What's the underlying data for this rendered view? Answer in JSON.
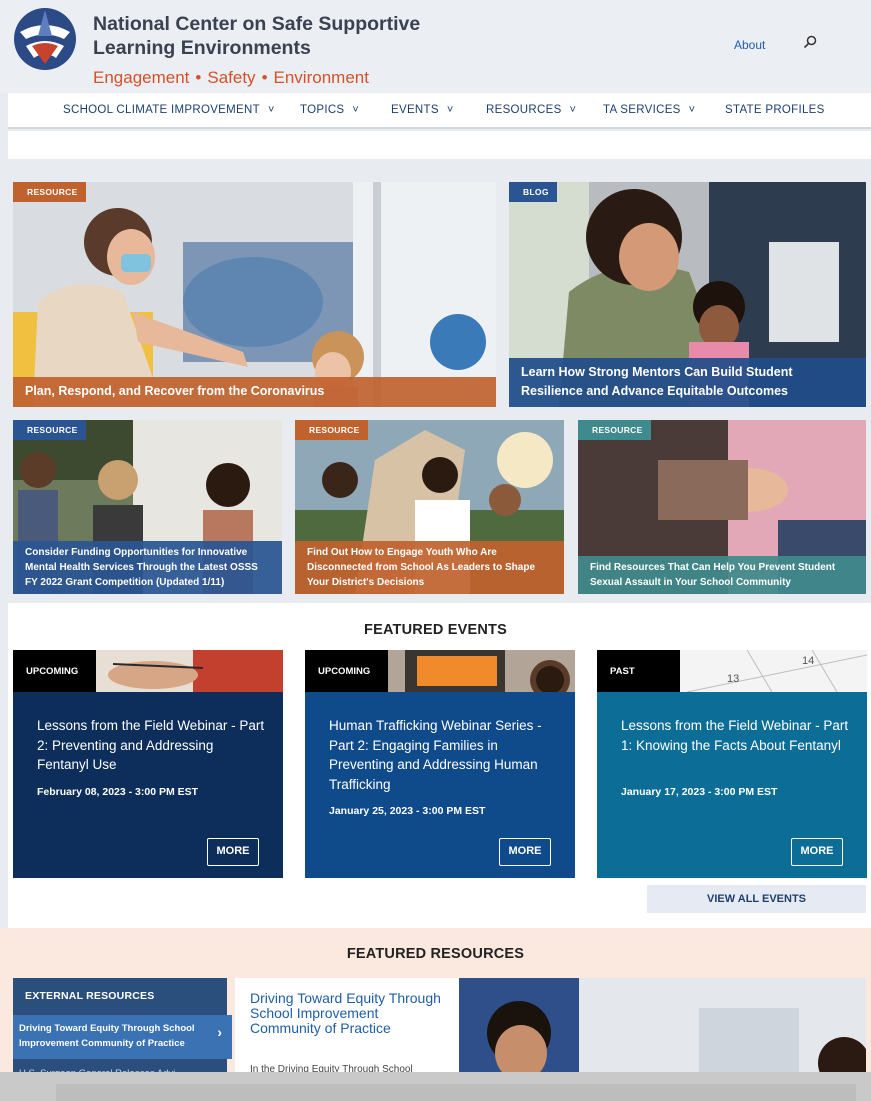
{
  "header": {
    "org_name": "National Center on Safe Supportive Learning Environments",
    "tagline": [
      "Engagement",
      "Safety",
      "Environment"
    ],
    "about": "About",
    "search_icon": "search-icon"
  },
  "nav": {
    "items": [
      {
        "label": "SCHOOL CLIMATE IMPROVEMENT",
        "chevron": "˅"
      },
      {
        "label": "TOPICS",
        "chevron": "˅"
      },
      {
        "label": "EVENTS",
        "chevron": "˅"
      },
      {
        "label": "RESOURCES",
        "chevron": "˅"
      },
      {
        "label": "TA SERVICES",
        "chevron": "˅"
      },
      {
        "label": "STATE PROFILES",
        "chevron": ""
      }
    ]
  },
  "hero": {
    "tiles": [
      {
        "tag": "RESOURCE",
        "caption": "Plan, Respond, and Recover from the Coronavirus"
      },
      {
        "tag": "BLOG",
        "caption": "Learn How Strong Mentors Can Build Student Resilience and Advance Equitable Outcomes"
      },
      {
        "tag": "RESOURCE",
        "caption": "Consider Funding Opportunities for Innovative Mental Health Services Through the Latest OSSS FY 2022 Grant Competition (Updated 1/11)"
      },
      {
        "tag": "RESOURCE",
        "caption": "Find Out How to Engage Youth Who Are Disconnected from School As Leaders to Shape Your District's Decisions"
      },
      {
        "tag": "RESOURCE",
        "caption": "Find Resources That Can Help You Prevent Student Sexual Assault in Your School Community"
      }
    ]
  },
  "events": {
    "title": "FEATURED EVENTS",
    "cards": [
      {
        "status": "UPCOMING",
        "title": "Lessons from the Field Webinar - Part 2: Preventing and Addressing Fentanyl Use",
        "date": "February 08, 2023 - 3:00 PM EST",
        "more": "MORE"
      },
      {
        "status": "UPCOMING",
        "title": "Human Trafficking Webinar Series - Part 2: Engaging Families in Preventing and Addressing Human Trafficking",
        "date": "January 25, 2023 - 3:00 PM EST",
        "more": "MORE"
      },
      {
        "status": "PAST",
        "title": "Lessons from the Field Webinar - Part 1: Knowing the Facts About Fentanyl",
        "date": "January 17, 2023 - 3:00 PM EST",
        "more": "MORE"
      }
    ],
    "view_all": "VIEW ALL EVENTS",
    "calendar_numbers": [
      "13",
      "14"
    ]
  },
  "resources": {
    "title": "FEATURED RESOURCES",
    "sidebar_title": "EXTERNAL RESOURCES",
    "sidebar_item": "Driving Toward Equity Through School Improvement Community of Practice",
    "sidebar_next": "U.S. Surgeon General Releases Advi...",
    "main_title": "Driving Toward Equity Through School Improvement Community of Practice",
    "main_text": "In the Driving Equity Through School"
  },
  "colors": {
    "orange": "#c0622e",
    "blue_tag": "#2a5592",
    "teal_tag": "#3f8a8c",
    "event_navy": "#0d2e5a",
    "event_blue": "#0f4a8a",
    "event_teal": "#0c6d96"
  }
}
